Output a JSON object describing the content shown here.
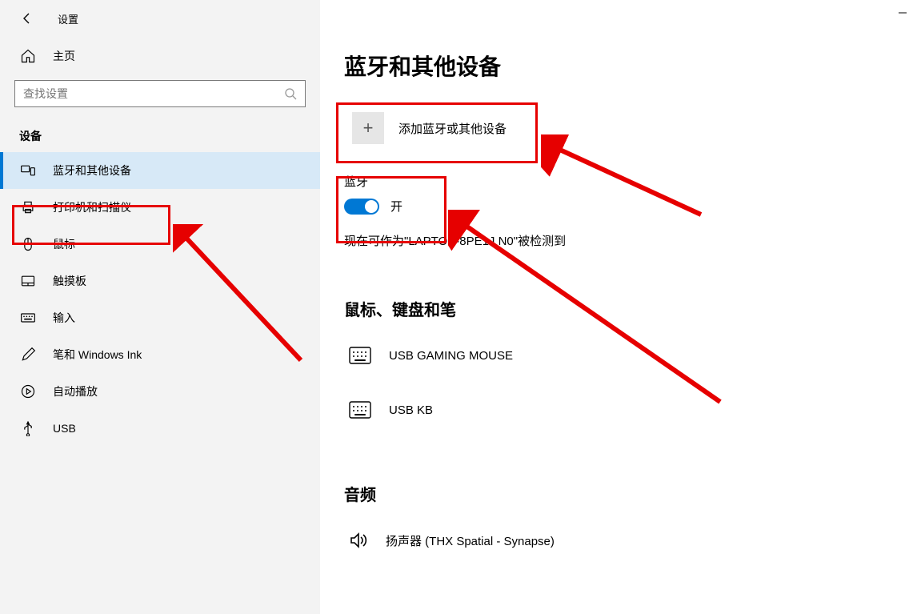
{
  "app_title": "设置",
  "sidebar": {
    "home_label": "主页",
    "search_placeholder": "查找设置",
    "section_label": "设备",
    "items": [
      {
        "id": "bluetooth",
        "label": "蓝牙和其他设备",
        "icon": "devices",
        "active": true
      },
      {
        "id": "printers",
        "label": "打印机和扫描仪",
        "icon": "printer"
      },
      {
        "id": "mouse",
        "label": "鼠标",
        "icon": "mouse"
      },
      {
        "id": "touchpad",
        "label": "触摸板",
        "icon": "touchpad"
      },
      {
        "id": "typing",
        "label": "输入",
        "icon": "keyboard"
      },
      {
        "id": "pen",
        "label": "笔和 Windows Ink",
        "icon": "pen"
      },
      {
        "id": "autoplay",
        "label": "自动播放",
        "icon": "autoplay"
      },
      {
        "id": "usb",
        "label": "USB",
        "icon": "usb"
      }
    ]
  },
  "main": {
    "page_title": "蓝牙和其他设备",
    "add_device_label": "添加蓝牙或其他设备",
    "bluetooth_heading": "蓝牙",
    "toggle_state_label": "开",
    "discoverable_text": "现在可作为\"LAPTOP-8PE1J  N0\"被检测到",
    "group_mkb_heading": "鼠标、键盘和笔",
    "devices_mkb": [
      {
        "name": "USB GAMING MOUSE",
        "icon": "keyboard"
      },
      {
        "name": "USB KB",
        "icon": "keyboard"
      }
    ],
    "group_audio_heading": "音频",
    "devices_audio": [
      {
        "name": "扬声器 (THX Spatial - Synapse)",
        "icon": "speaker"
      }
    ]
  },
  "annotation": {
    "purpose": "red callout boxes and arrows highlighting the add-device button, bluetooth toggle area, and bluetooth nav item"
  }
}
